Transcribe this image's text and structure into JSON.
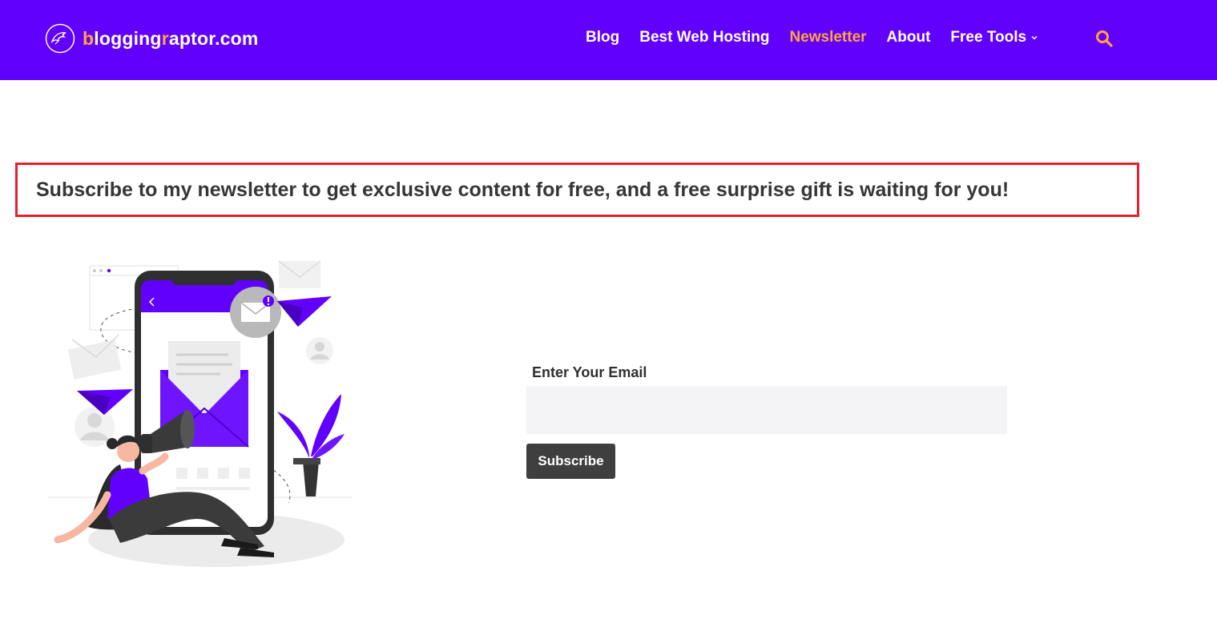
{
  "brand": {
    "logo_parts": [
      "b",
      "logging",
      "r",
      "aptor.com"
    ],
    "brand_color": "#6200fe",
    "accent_color": "#ffa53a"
  },
  "nav": {
    "items": [
      {
        "label": "Blog",
        "active": false
      },
      {
        "label": "Best Web Hosting",
        "active": false
      },
      {
        "label": "Newsletter",
        "active": true
      },
      {
        "label": "About",
        "active": false
      },
      {
        "label": "Free Tools",
        "active": false,
        "dropdown": true
      }
    ],
    "search_icon": "search-icon"
  },
  "main": {
    "headline": "Subscribe to my newsletter to get exclusive content for free, and a free surprise gift is waiting for you!",
    "highlight_color": "#e1232e",
    "illustration": "newsletter-illustration",
    "form": {
      "email_label": "Enter Your Email",
      "email_value": "",
      "subscribe_label": "Subscribe"
    }
  }
}
